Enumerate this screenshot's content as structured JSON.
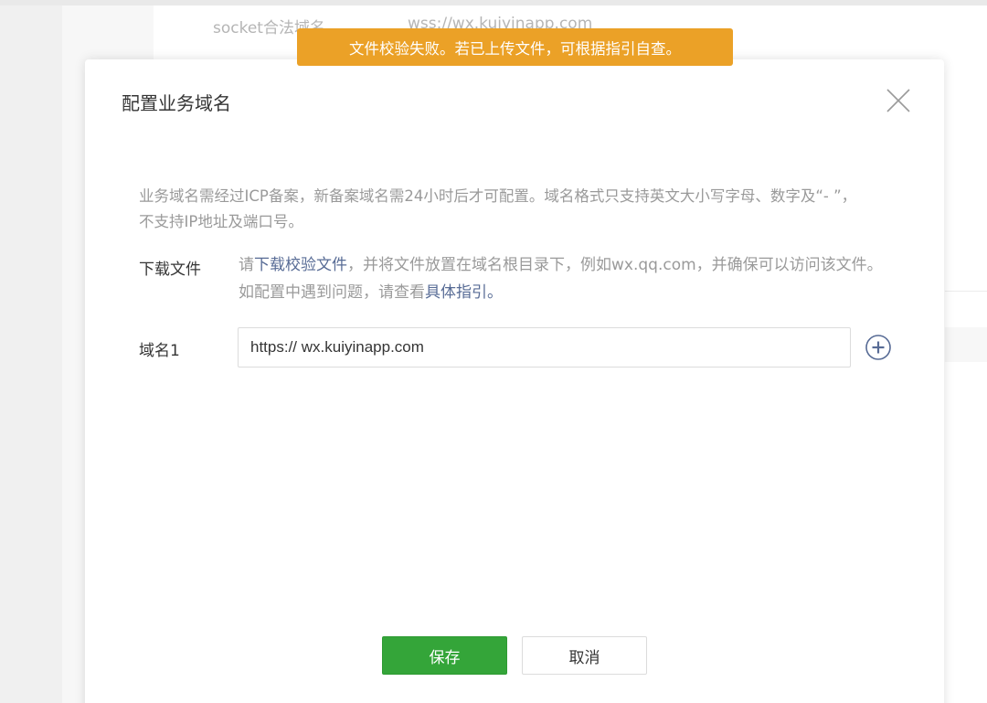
{
  "background": {
    "socket_label": "socket合法域名",
    "socket_value": "wss://wx.kuiyinapp.com"
  },
  "toast": {
    "message": "文件校验失败。若已上传文件，可根据指引自查。",
    "color": "#eba127"
  },
  "modal": {
    "title": "配置业务域名",
    "close_icon": "close-icon",
    "notice": "业务域名需经过ICP备案，新备案域名需24小时后才可配置。域名格式只支持英文大小写字母、数字及“- ”，不支持IP地址及端口号。",
    "download": {
      "label": "下载文件",
      "text_before": "请",
      "link_download": "下载校验文件",
      "text_middle": "，并将文件放置在域名根目录下，例如wx.qq.com，并确保可以访问该文件。如配置中遇到问题，请查看",
      "link_guide": "具体指引。"
    },
    "domain": {
      "label": "域名1",
      "value": "https:// wx.kuiyinapp.com",
      "add_icon": "plus-circle-icon"
    },
    "buttons": {
      "save": "保存",
      "cancel": "取消"
    },
    "colors": {
      "primary": "#34a539",
      "link": "#576b95"
    }
  }
}
